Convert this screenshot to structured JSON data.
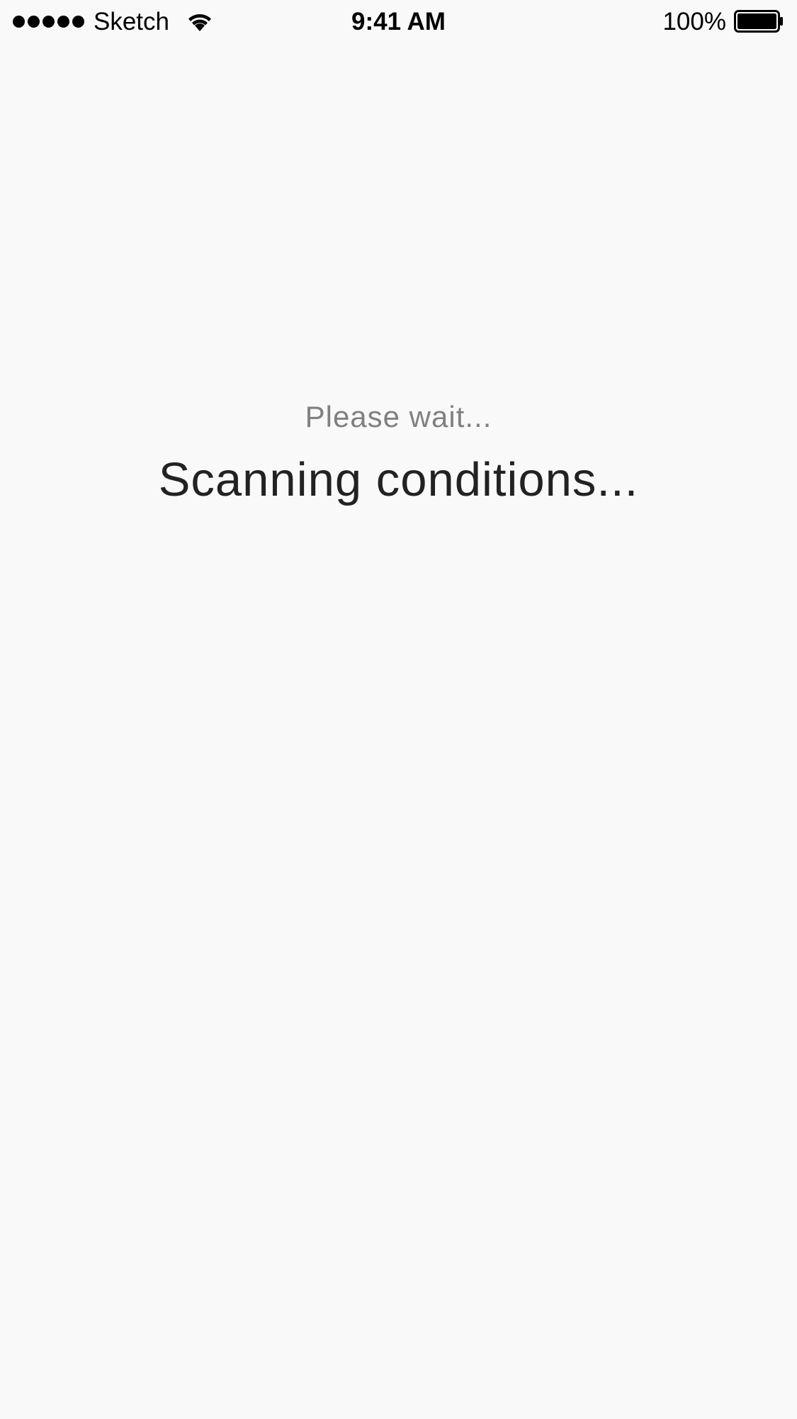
{
  "status_bar": {
    "signal_icon": "signal-dots-icon",
    "carrier": "Sketch",
    "wifi_icon": "wifi-icon",
    "time": "9:41 AM",
    "battery_percent": "100%",
    "battery_icon": "battery-icon",
    "battery_level": 1.0
  },
  "loading": {
    "subtitle": "Please wait...",
    "title": "Scanning conditions..."
  },
  "colors": {
    "background": "#f9f9f9",
    "subtitle": "#808080",
    "title": "#222222"
  }
}
